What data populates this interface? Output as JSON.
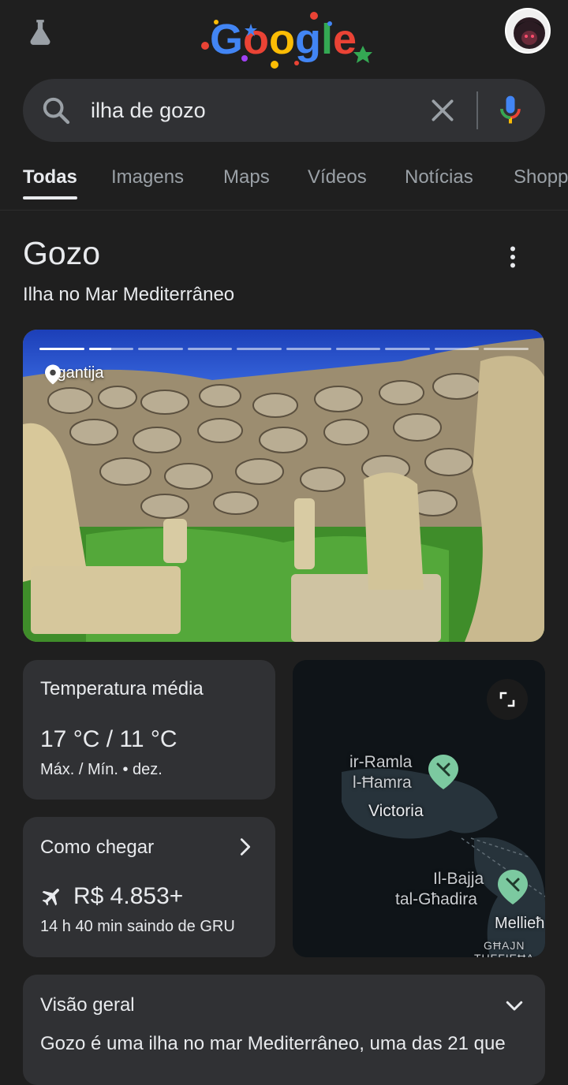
{
  "header": {
    "labs_icon": "flask-icon",
    "logo_text": "Google",
    "avatar": "avatar"
  },
  "search": {
    "query": "ilha de gozo",
    "icons": [
      "search-icon",
      "close-icon",
      "mic-icon"
    ]
  },
  "tabs": [
    {
      "label": "Todas",
      "active": true
    },
    {
      "label": "Imagens"
    },
    {
      "label": "Maps"
    },
    {
      "label": "Vídeos"
    },
    {
      "label": "Notícias"
    },
    {
      "label": "Shopp"
    }
  ],
  "knowledge_panel": {
    "title": "Gozo",
    "subtitle": "Ilha no Mar Mediterrâneo",
    "photo": {
      "location_label": "Ggantija",
      "segments": 10,
      "current_segment_progress": 0.5
    }
  },
  "temperature_card": {
    "title": "Temperatura média",
    "value": "17 °C / 11 °C",
    "meta": "Máx. / Mín. • dez."
  },
  "travel_card": {
    "title": "Como chegar",
    "price": "R$ 4.853+",
    "meta": "14 h 40 min saindo de GRU"
  },
  "map_card": {
    "labels": {
      "ramla_1": "ir-Ramla",
      "ramla_2": "l-Ħamra",
      "victoria": "Victoria",
      "bajja_1": "Il-Bajja",
      "bajja_2": "tal-Għadira",
      "mellieha": "Mellieħ",
      "ghajn": "GĦAJN",
      "tuffieha": "TUFFIEĦA"
    }
  },
  "overview": {
    "title": "Visão geral",
    "body": "Gozo é uma ilha no mar Mediterrâneo, uma das 21 que"
  },
  "colors": {
    "background": "#1f1f1f",
    "card": "#303134",
    "text": "#e8eaed",
    "muted": "#9aa0a6",
    "map_pin": "#7cc9a0"
  }
}
